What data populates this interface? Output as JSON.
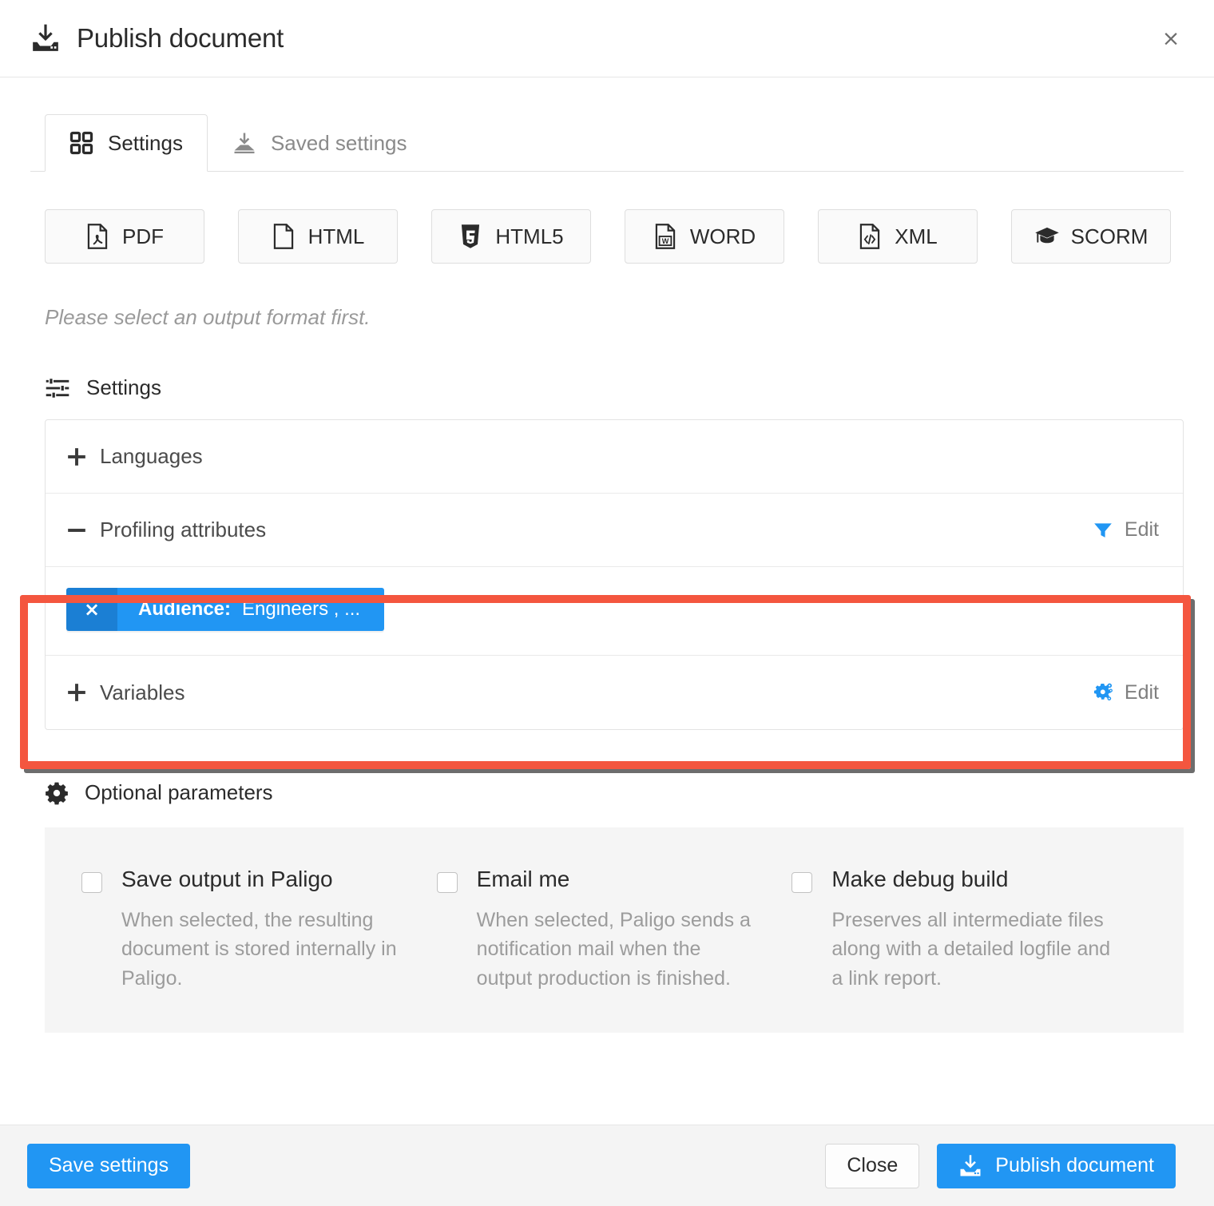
{
  "dialog": {
    "title": "Publish document",
    "title_icon": "publish-download-icon",
    "close_label": "×"
  },
  "tabs": [
    {
      "label": "Settings",
      "icon": "grid-squares-icon",
      "active": true
    },
    {
      "label": "Saved settings",
      "icon": "download-tray-icon",
      "active": false
    }
  ],
  "formats": [
    {
      "label": "PDF",
      "icon": "pdf-file-icon"
    },
    {
      "label": "HTML",
      "icon": "page-file-icon"
    },
    {
      "label": "HTML5",
      "icon": "html5-shield-icon"
    },
    {
      "label": "WORD",
      "icon": "word-file-icon"
    },
    {
      "label": "XML",
      "icon": "xml-code-file-icon"
    },
    {
      "label": "SCORM",
      "icon": "graduation-cap-icon"
    }
  ],
  "notice": "Please select an output format first.",
  "settings_section": {
    "heading": "Settings",
    "heading_icon": "sliders-icon",
    "rows": [
      {
        "sign": "+",
        "label": "Languages",
        "edit": null
      },
      {
        "sign": "–",
        "label": "Profiling attributes",
        "edit": "Edit",
        "edit_icon": "filter-funnel-icon"
      },
      {
        "sign": "+",
        "label": "Variables",
        "edit": "Edit",
        "edit_icon": "cogs-icon"
      }
    ],
    "profiling_chip": {
      "remove_label": "×",
      "key": "Audience:",
      "value": "Engineers , ..."
    }
  },
  "optional_parameters": {
    "heading": "Optional parameters",
    "heading_icon": "gear-icon",
    "options": [
      {
        "label": "Save output in Paligo",
        "description": "When selected, the resulting document is stored internally in Paligo.",
        "checked": false
      },
      {
        "label": "Email me",
        "description": "When selected, Paligo sends a notification mail when the output production is finished.",
        "checked": false
      },
      {
        "label": "Make debug build",
        "description": "Preserves all intermediate files along with a detailed logfile and a link report.",
        "checked": false
      }
    ]
  },
  "footer": {
    "save_settings_label": "Save settings",
    "close_label": "Close",
    "publish_label": "Publish document",
    "publish_icon": "publish-download-icon"
  },
  "colors": {
    "accent_blue": "#2196f3",
    "chip_dark_blue": "#1b7fd4",
    "highlight_red": "#f4563f",
    "panel_gray": "#f5f5f5",
    "text_dark": "#2b2b2b",
    "text_muted": "#9c9c9c"
  }
}
